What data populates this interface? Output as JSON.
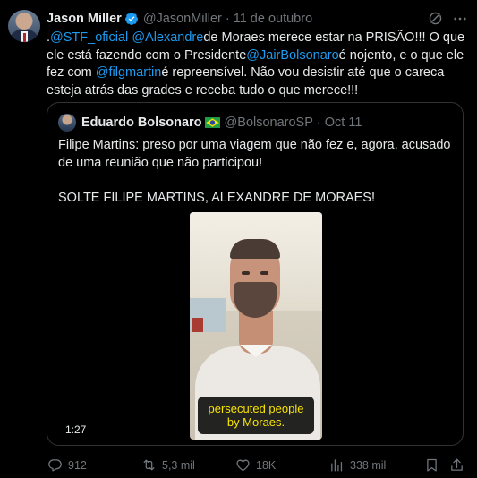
{
  "tweet": {
    "author_name": "Jason Miller",
    "author_handle": "@JasonMiller",
    "separator": "·",
    "date": "11 de outubro",
    "text": {
      "p1": ".",
      "mention_stf": "@STF_oficial",
      "space1": " ",
      "mention_alexandre": "@Alexandre",
      "p2": "de Moraes merece estar na PRISÃO!!! O que ele está fazendo com o Presidente",
      "mention_jair": "@JairBolsonaro",
      "p3": "é nojento, e o que ele fez com ",
      "mention_filg": "@filgmartin",
      "p4": "é repreensível. Não vou desistir até que o careca esteja atrás das grades e receba tudo o que merece!!!"
    }
  },
  "quote": {
    "author_name": "Eduardo Bolsonaro",
    "author_handle": "@BolsonaroSP",
    "separator": "·",
    "date": "Oct 11",
    "line1": "Filipe Martins: preso por uma viagem que não fez e, agora, acusado de uma reunião que não participou!",
    "line2": "SOLTE FILIPE MARTINS, ALEXANDRE DE MORAES!",
    "video": {
      "caption_line1": "persecuted people",
      "caption_line2": "by Moraes.",
      "duration": "1:27"
    }
  },
  "actions": {
    "replies": "912",
    "reposts": "5,3 mil",
    "likes": "18K",
    "views": "338 mil"
  },
  "colors": {
    "background": "#000000",
    "text": "#e7e9ea",
    "secondary": "#71767b",
    "link": "#1d9bf0",
    "border": "#2f3336",
    "caption": "#f7e300"
  },
  "icons": [
    "verified-badge-icon",
    "grok-icon",
    "more-icon",
    "brazil-flag-icon",
    "reply-icon",
    "repost-icon",
    "like-icon",
    "views-icon",
    "bookmark-icon",
    "share-icon"
  ]
}
